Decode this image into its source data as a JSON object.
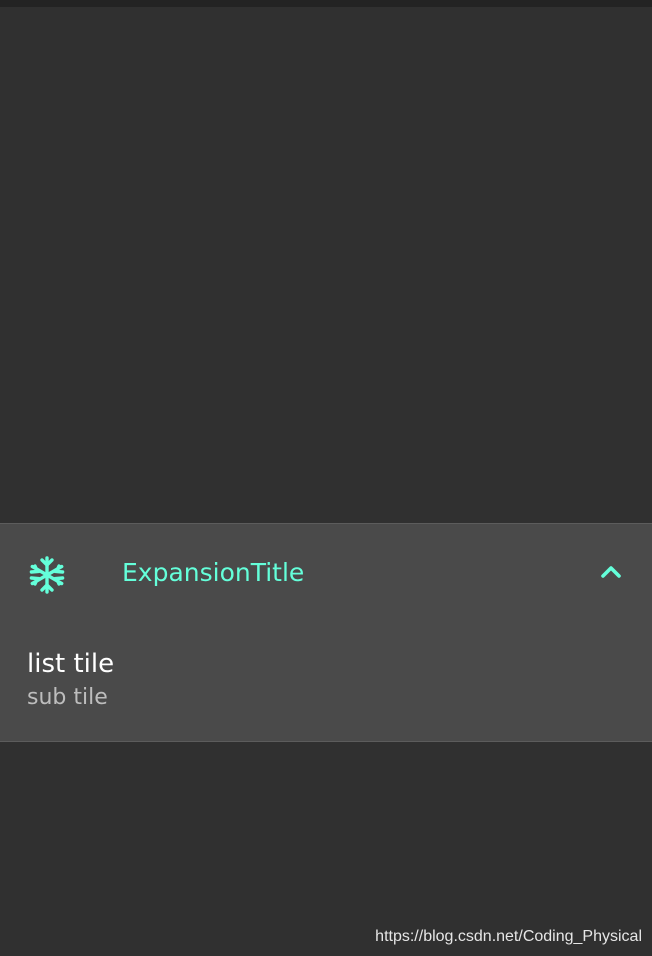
{
  "colors": {
    "background": "#303030",
    "tile_background": "#4a4a4a",
    "accent": "#64ffda",
    "text_primary": "#ffffff",
    "text_secondary": "#bdbdbd"
  },
  "expansion_tile": {
    "leading_icon": "ac-unit-snowflake-icon",
    "title": "ExpansionTitle",
    "trailing_icon": "expand-less-chevron-up-icon",
    "expanded": true,
    "children": [
      {
        "title": "list tile",
        "subtitle": "sub tile"
      }
    ]
  },
  "watermark": "https://blog.csdn.net/Coding_Physical"
}
